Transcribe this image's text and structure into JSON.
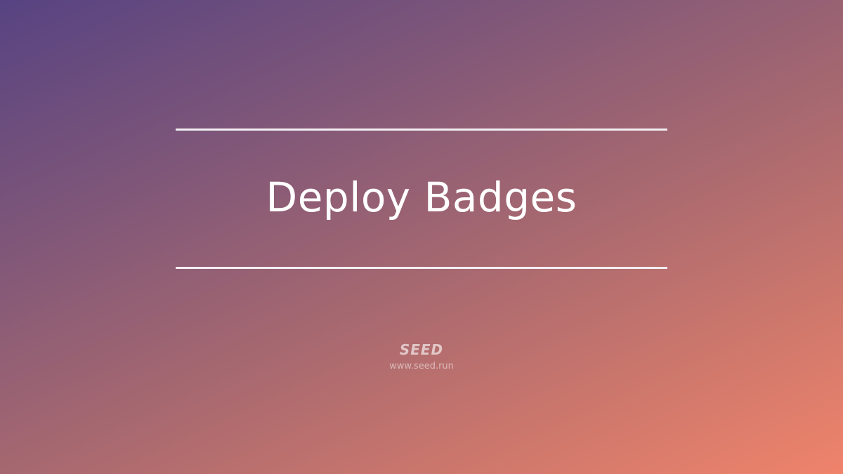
{
  "title": "Deploy Badges",
  "brand": {
    "name": "SEED",
    "url": "www.seed.run"
  },
  "colors": {
    "gradient_start": "#574382",
    "gradient_end": "#ef836b",
    "rule": "#f3eef2",
    "text": "#ffffff"
  }
}
